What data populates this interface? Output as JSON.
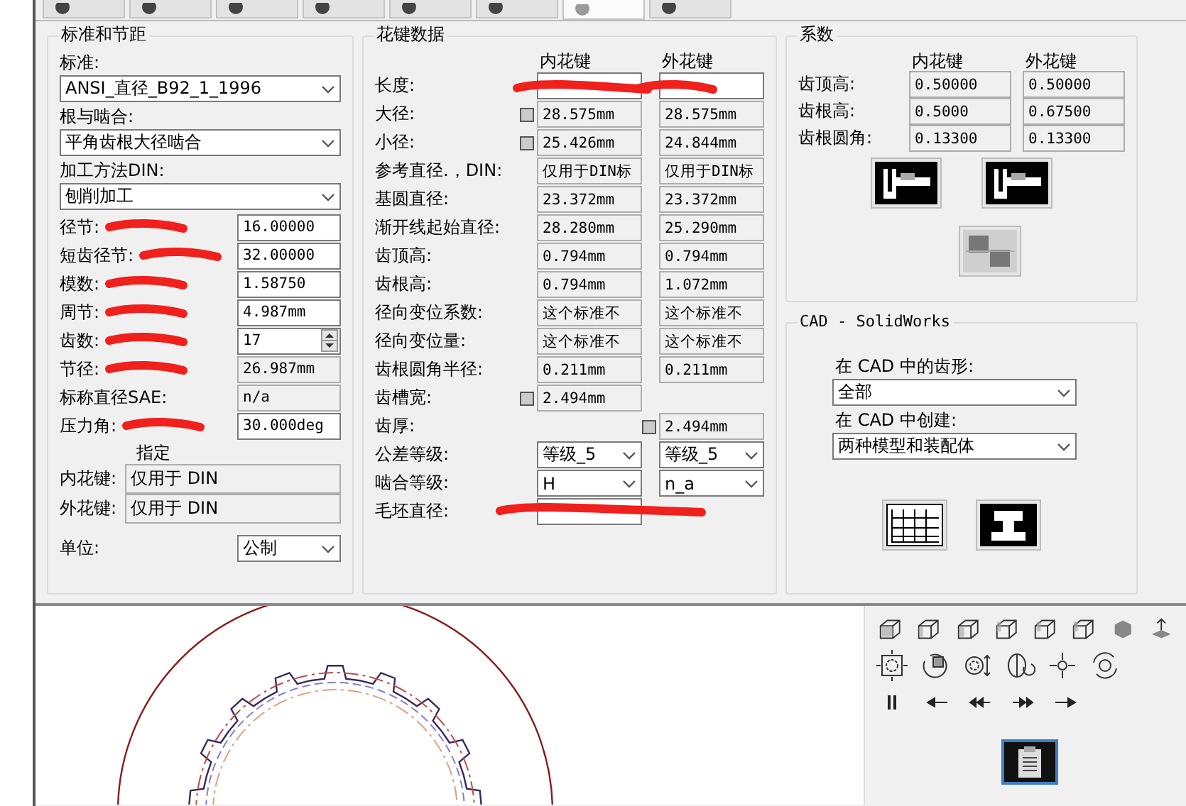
{
  "tabs": [
    {
      "selected": false
    },
    {
      "selected": false
    },
    {
      "selected": false
    },
    {
      "selected": false
    },
    {
      "selected": false
    },
    {
      "selected": false
    },
    {
      "selected": true
    },
    {
      "selected": false
    }
  ],
  "standard_group": {
    "title": "标准和节距",
    "selects": [
      {
        "label": "标准:",
        "value": "ANSI_直径_B92_1_1996"
      },
      {
        "label": "根与啮合:",
        "value": "平角齿根大径啮合"
      },
      {
        "label": "加工方法DIN:",
        "value": "刨削加工"
      }
    ],
    "rows": [
      {
        "label": "径节:",
        "value": "16.00000",
        "kind": "input",
        "redacted": true
      },
      {
        "label": "短齿径节:",
        "value": "32.00000",
        "kind": "input",
        "redacted": true
      },
      {
        "label": "模数:",
        "value": "1.58750",
        "kind": "input",
        "redacted": true
      },
      {
        "label": "周节:",
        "value": "4.987mm",
        "kind": "input",
        "redacted": true
      },
      {
        "label": "齿数:",
        "value": "17",
        "kind": "spin",
        "redacted": true
      },
      {
        "label": "节径:",
        "value": "26.987mm",
        "kind": "readonly",
        "redacted": true
      },
      {
        "label": "标称直径SAE:",
        "value": "n/a",
        "kind": "readonly",
        "redacted": false
      },
      {
        "label": "压力角:",
        "value": "30.000deg",
        "kind": "input",
        "redacted": true
      }
    ],
    "designation": {
      "title": "指定",
      "rows": [
        {
          "label": "内花键:",
          "value": "仅用于 DIN"
        },
        {
          "label": "外花键:",
          "value": "仅用于 DIN"
        }
      ]
    },
    "unit": {
      "label": "单位:",
      "value": "公制"
    }
  },
  "spline_data": {
    "title": "花键数据",
    "columns": [
      "内花键",
      "外花键"
    ],
    "rows": [
      {
        "label": "长度:",
        "redacted": true,
        "cells": [
          {
            "kind": "input",
            "locked": false
          },
          {
            "kind": "input",
            "locked": false
          }
        ]
      },
      {
        "label": "大径:",
        "redacted": false,
        "cells": [
          {
            "kind": "readonly",
            "value": "28.575mm",
            "locked": true
          },
          {
            "kind": "readonly",
            "value": "28.575mm",
            "locked": false
          }
        ]
      },
      {
        "label": "小径:",
        "redacted": false,
        "cells": [
          {
            "kind": "readonly",
            "value": "25.426mm",
            "locked": true
          },
          {
            "kind": "readonly",
            "value": "24.844mm",
            "locked": false
          }
        ]
      },
      {
        "label": "参考直径.，DIN:",
        "redacted": false,
        "cells": [
          {
            "kind": "readonly",
            "value": "仅用于DIN标",
            "locked": false
          },
          {
            "kind": "readonly",
            "value": "仅用于DIN标",
            "locked": false
          }
        ]
      },
      {
        "label": "基圆直径:",
        "redacted": false,
        "cells": [
          {
            "kind": "readonly",
            "value": "23.372mm",
            "locked": false
          },
          {
            "kind": "readonly",
            "value": "23.372mm",
            "locked": false
          }
        ]
      },
      {
        "label": "渐开线起始直径:",
        "redacted": false,
        "cells": [
          {
            "kind": "readonly",
            "value": "28.280mm",
            "locked": false
          },
          {
            "kind": "readonly",
            "value": "25.290mm",
            "locked": false
          }
        ]
      },
      {
        "label": "齿顶高:",
        "redacted": false,
        "cells": [
          {
            "kind": "readonly",
            "value": "0.794mm",
            "locked": false
          },
          {
            "kind": "readonly",
            "value": "0.794mm",
            "locked": false
          }
        ]
      },
      {
        "label": "齿根高:",
        "redacted": false,
        "cells": [
          {
            "kind": "readonly",
            "value": "0.794mm",
            "locked": false
          },
          {
            "kind": "readonly",
            "value": "1.072mm",
            "locked": false
          }
        ]
      },
      {
        "label": "径向变位系数:",
        "redacted": false,
        "cells": [
          {
            "kind": "readonly",
            "value": "这个标准不",
            "locked": false
          },
          {
            "kind": "readonly",
            "value": "这个标准不",
            "locked": false
          }
        ]
      },
      {
        "label": "径向变位量:",
        "redacted": false,
        "cells": [
          {
            "kind": "readonly",
            "value": "这个标准不",
            "locked": false
          },
          {
            "kind": "readonly",
            "value": "这个标准不",
            "locked": false
          }
        ]
      },
      {
        "label": "齿根圆角半径:",
        "redacted": false,
        "cells": [
          {
            "kind": "readonly",
            "value": "0.211mm",
            "locked": false
          },
          {
            "kind": "readonly",
            "value": "0.211mm",
            "locked": false
          }
        ]
      },
      {
        "label": "齿槽宽:",
        "redacted": false,
        "cells": [
          {
            "kind": "readonly",
            "value": "2.494mm",
            "locked": true
          },
          {
            "kind": "none",
            "locked": false
          }
        ]
      },
      {
        "label": "齿厚:",
        "redacted": false,
        "cells": [
          {
            "kind": "none",
            "locked": false
          },
          {
            "kind": "readonly",
            "value": "2.494mm",
            "locked": true
          }
        ]
      },
      {
        "label": "公差等级:",
        "redacted": false,
        "cells": [
          {
            "kind": "combo",
            "value": "等级_5",
            "locked": false
          },
          {
            "kind": "combo",
            "value": "等级_5",
            "locked": false
          }
        ]
      },
      {
        "label": "啮合等级:",
        "redacted": false,
        "cells": [
          {
            "kind": "combo",
            "value": "H",
            "locked": false
          },
          {
            "kind": "combo",
            "value": "n_a",
            "locked": false
          }
        ]
      },
      {
        "label": "毛坯直径:",
        "redacted": true,
        "cells": [
          {
            "kind": "input",
            "locked": false
          },
          {
            "kind": "none",
            "locked": false
          }
        ]
      }
    ]
  },
  "coefficients": {
    "title": "系数",
    "columns": [
      "内花键",
      "外花键"
    ],
    "rows": [
      {
        "label": "齿顶高:",
        "values": [
          "0.50000",
          "0.50000"
        ]
      },
      {
        "label": "齿根高:",
        "values": [
          "0.5000",
          "0.67500"
        ]
      },
      {
        "label": "齿根圆角:",
        "values": [
          "0.13300",
          "0.13300"
        ]
      }
    ]
  },
  "cad": {
    "title": "CAD - SolidWorks",
    "selects": [
      {
        "label": "在 CAD 中的齿形:",
        "value": "全部"
      },
      {
        "label": "在 CAD 中创建:",
        "value": "两种模型和装配体"
      }
    ]
  }
}
